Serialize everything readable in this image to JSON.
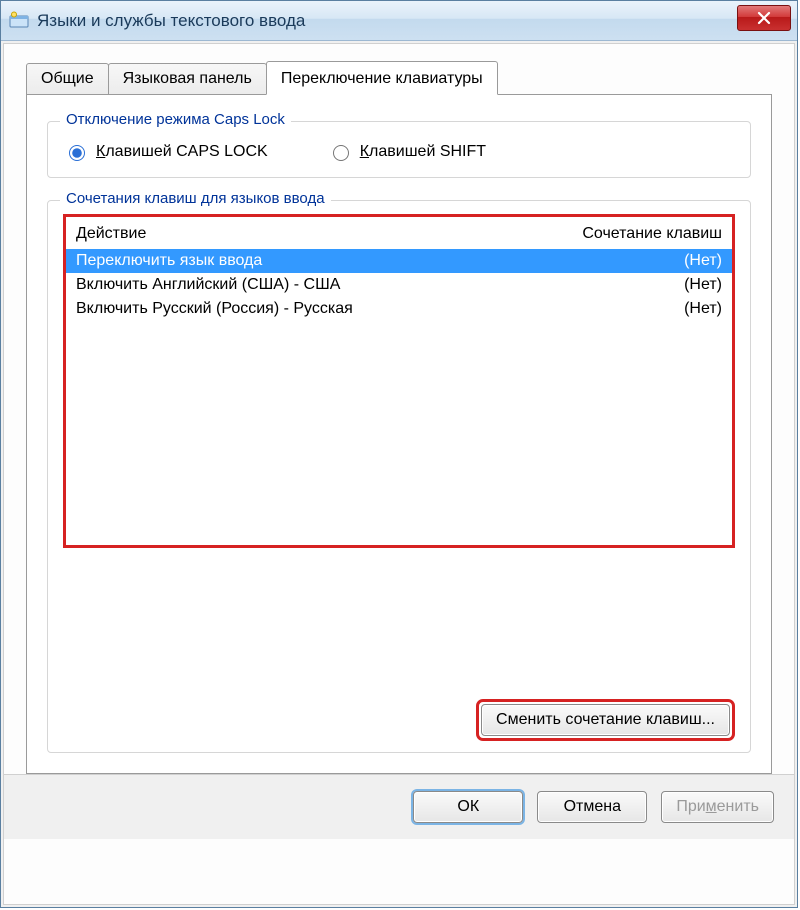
{
  "window": {
    "title": "Языки и службы текстового ввода"
  },
  "tabs": {
    "general": "Общие",
    "langbar": "Языковая панель",
    "switching": "Переключение клавиатуры"
  },
  "capslock_group": {
    "legend": "Отключение режима Caps Lock",
    "option_capslock_pre": "К",
    "option_capslock_rest": "лавишей CAPS LOCK",
    "option_shift_pre": "К",
    "option_shift_rest": "лавишей SHIFT"
  },
  "hotkeys_group": {
    "legend": "Сочетания клавиш для языков ввода",
    "header_action": "Действие",
    "header_hotkey": "Сочетание клавиш",
    "rows": [
      {
        "action": "Переключить язык ввода",
        "hotkey": "(Нет)"
      },
      {
        "action": "Включить Английский (США) - США",
        "hotkey": "(Нет)"
      },
      {
        "action": "Включить Русский (Россия) - Русская",
        "hotkey": "(Нет)"
      }
    ],
    "change_button": "Сменить сочетание клавиш..."
  },
  "footer": {
    "ok": "ОК",
    "cancel": "Отмена",
    "apply_pre": "При",
    "apply_u": "м",
    "apply_rest": "енить"
  }
}
